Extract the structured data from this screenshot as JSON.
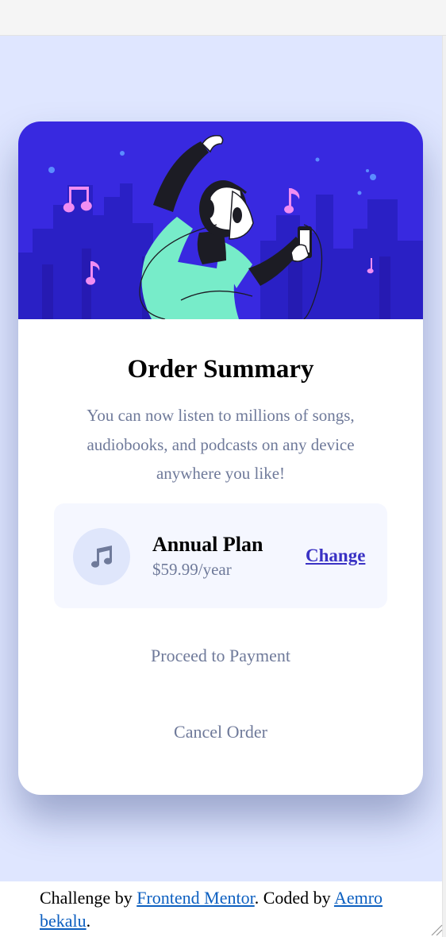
{
  "card": {
    "title": "Order Summary",
    "description": "You can now listen to millions of songs, audiobooks, and podcasts on any device anywhere you like!"
  },
  "plan": {
    "icon": "music-note-icon",
    "name": "Annual Plan",
    "price": "$59.99/year",
    "change_label": "Change"
  },
  "actions": {
    "proceed_label": "Proceed to Payment",
    "cancel_label": "Cancel Order"
  },
  "footer": {
    "prefix": "Challenge by ",
    "link1": "Frontend Mentor",
    "middle": ". Coded by ",
    "link2": "Aemro bekalu",
    "suffix": "."
  },
  "colors": {
    "page_background": "#dfe6ff",
    "hero_blue": "#3829e0",
    "primary_text": "#000000",
    "muted_text": "#6f7a9a",
    "accent": "#3a32c4",
    "link": "#0c5fc0"
  }
}
